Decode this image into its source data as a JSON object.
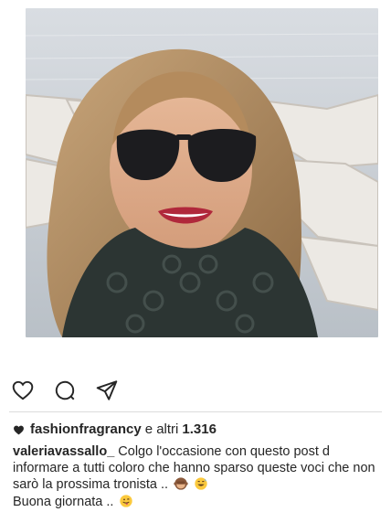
{
  "post": {
    "likes": {
      "first_user": "fashionfragrancy",
      "connector": "e altri",
      "count": "1.316"
    },
    "caption": {
      "username": "valeriavassallo_",
      "text": "Colgo l'occasione con questo post d informare a tutti coloro che hanno sparso queste voci che non sarò la prossima tronista",
      "text_suffix": "..",
      "second_line": "Buona giornata .."
    }
  },
  "icons": [
    "like-icon",
    "comment-icon",
    "share-icon",
    "heart-small-icon",
    "monkey-emoji-icon",
    "sweat-smile-emoji-icon",
    "tongue-emoji-icon"
  ],
  "colors": {
    "text": "#262626",
    "divider": "#dbdbdb"
  }
}
